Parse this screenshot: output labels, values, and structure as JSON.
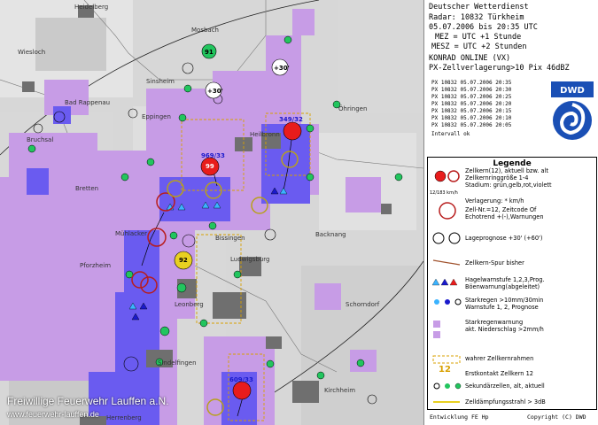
{
  "header": {
    "title": "Deutscher Wetterdienst",
    "radar": "Radar: 10832 Türkheim",
    "time": "05.07.2006 bis 20:35 UTC",
    "mez": "MEZ  = UTC +1 Stunde",
    "mesz": "MESZ = UTC +2 Stunden",
    "product": "KONRAD ONLINE (VX)",
    "shift": "PX-Zellverlagerung>10 Pix 46dBZ"
  },
  "px_list": [
    "PX 10832 05.07.2006 20:35",
    "PX 10832 05.07.2006 20:30",
    "PX 10832 05.07.2006 20:25",
    "PX 10832 05.07.2006 20:20",
    "PX 10832 05.07.2006 20:15",
    "PX 10832 05.07.2006 20:10",
    "PX 10832 05.07.2006 20:05"
  ],
  "interval_status": "Intervall ok",
  "logo_text": "DWD",
  "legend": {
    "title": "Legende",
    "cell_core": "Zellkern(12), aktuell bzw. alt\nZellkernringgröße 1-4\nStadium: grün,gelb,rot,violett",
    "shift_label": "Verlagerung: * km/h",
    "cell_nr": "Zell-Nr.=12, Zeitcode Of\nEchotrend +(-),Warnungen",
    "speed_sample": "12/183 km/h",
    "prognosis": "Lageprognose +30' (+60')",
    "track": "Zellkern-Spur bisher",
    "hail": "Hagelwarnstufe 1,2,3,Prog.\nBöenwarnung(abgeleitet)",
    "heavy_rain": "Starkregen >10mm/30min\nWarnstufe 1, 2, Prognose",
    "rain_warning": "Starkregenwarnung\nakt. Niederschlag >2mm/h",
    "frame": "wahrer Zellkernrahmen",
    "first_contact": "Erstkontakt Zellkern 12",
    "first_contact_num": "12",
    "secondary": "Sekundärzellen, alt, aktuell",
    "damping": "Zelldämpfungsstrahl > 3dB"
  },
  "footer": {
    "left": "Entwicklung FE Hp",
    "right": "Copyright (C) DWD"
  },
  "watermark": {
    "line1": "Freiwillige Feuerwehr Lauffen a.N.",
    "line2": "www.feuerwehr-lauffen.de"
  },
  "map": {
    "places": [
      "Heidelberg",
      "Wiesloch",
      "Mosbach",
      "Bruchsal",
      "Eppingen",
      "Heilbronn",
      "Öhringen",
      "Bretten",
      "Mühlacker",
      "Bissingen",
      "Backnang",
      "Pforzheim",
      "Ludwigsburg",
      "Schorndorf",
      "Leonberg",
      "Sindelfingen",
      "Herrenberg",
      "Kirchheim",
      "Bad Rappenau",
      "Sinsheim"
    ],
    "cell_labels": [
      "91",
      "+30'",
      "349/32",
      "969/33",
      "+30'",
      "92",
      "609/33",
      "99"
    ],
    "colors": {
      "rain": "#c79ce6",
      "heavy": "#6a5bf0",
      "core": "#e81c1c",
      "city": "#777777"
    }
  }
}
